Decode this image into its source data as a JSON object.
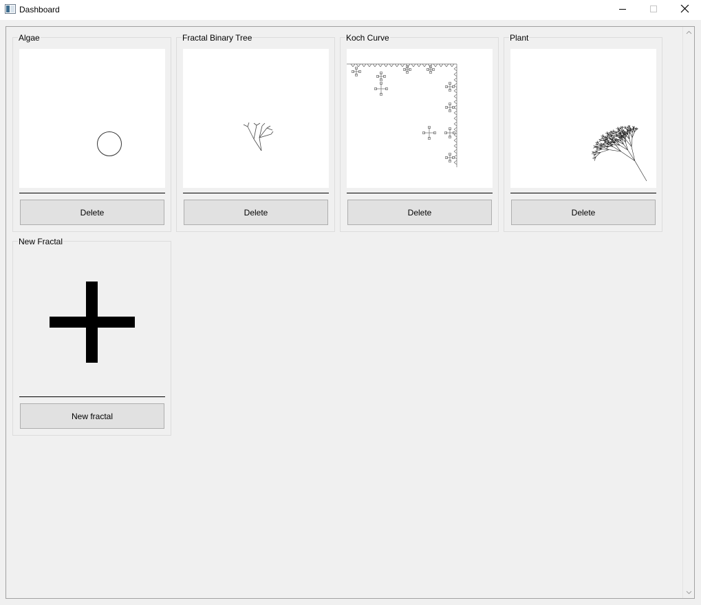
{
  "window": {
    "title": "Dashboard",
    "icons": {
      "app": "app-window-icon",
      "minimize": "minimize-icon",
      "maximize": "maximize-icon",
      "close": "close-icon"
    }
  },
  "cards": [
    {
      "title": "Algae",
      "button_label": "Delete",
      "preview": "algae-preview"
    },
    {
      "title": "Fractal Binary Tree",
      "button_label": "Delete",
      "preview": "binary-tree-preview"
    },
    {
      "title": "Koch Curve",
      "button_label": "Delete",
      "preview": "koch-curve-preview"
    },
    {
      "title": "Plant",
      "button_label": "Delete",
      "preview": "plant-preview"
    }
  ],
  "new_card": {
    "title": "New Fractal",
    "button_label": "New fractal",
    "icon": "plus-icon"
  },
  "scrollbar": {
    "up_icon": "scroll-up-arrow-icon",
    "down_icon": "scroll-down-arrow-icon"
  }
}
